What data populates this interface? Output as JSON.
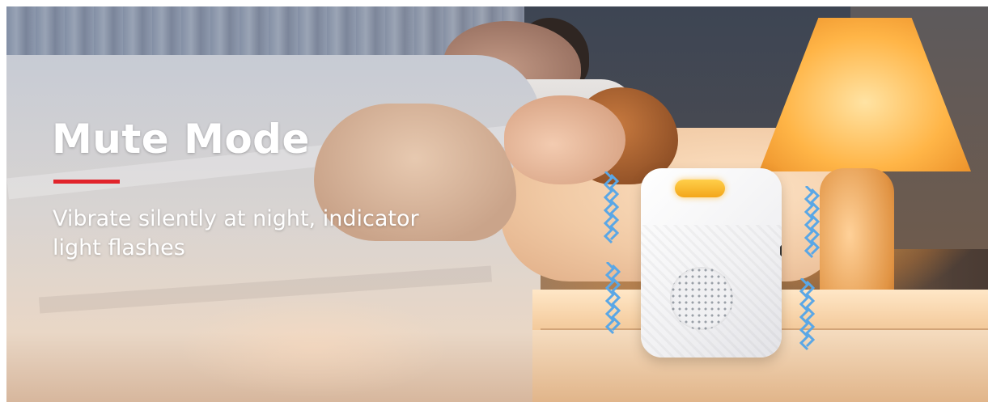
{
  "banner": {
    "title": "Mute Mode",
    "subtitle": "Vibrate silently at night, indicator light flashes",
    "accent_color": "#e1242b",
    "text_color": "#ffffff"
  },
  "scene": {
    "objects": [
      "bed",
      "two-sleepers",
      "nightstand",
      "table-lamp",
      "white-alarm-device",
      "vibration-waves"
    ],
    "device_indicator_color": "#f3a61a",
    "wave_color": "#5aa7e6"
  }
}
